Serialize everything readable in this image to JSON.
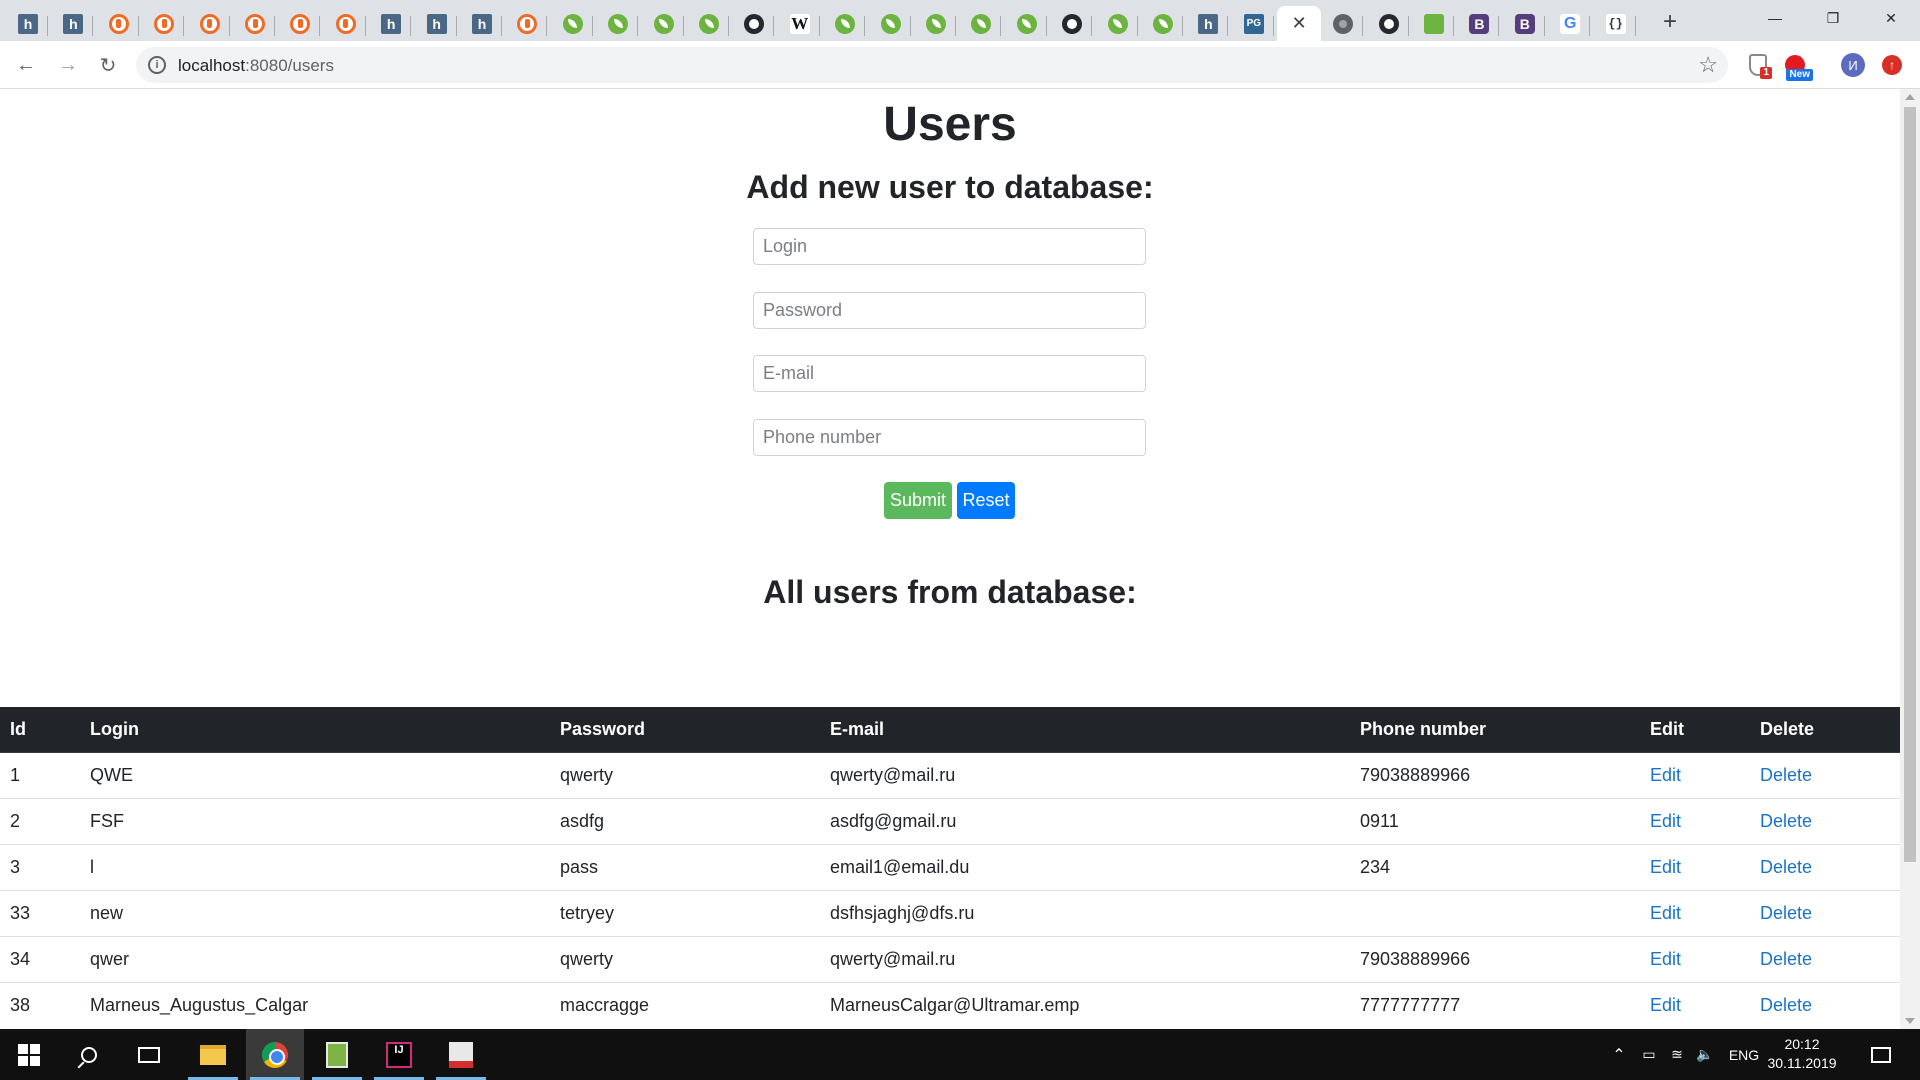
{
  "browser": {
    "tabs": [
      {
        "icon": "habr-icon",
        "glyph": "h"
      },
      {
        "icon": "habr-icon",
        "glyph": "h"
      },
      {
        "icon": "orange-site-icon",
        "glyph": ""
      },
      {
        "icon": "orange-site-icon",
        "glyph": ""
      },
      {
        "icon": "orange-site-icon",
        "glyph": ""
      },
      {
        "icon": "orange-site-icon",
        "glyph": ""
      },
      {
        "icon": "orange-site-icon",
        "glyph": ""
      },
      {
        "icon": "orange-site-icon",
        "glyph": ""
      },
      {
        "icon": "habr-icon",
        "glyph": "h"
      },
      {
        "icon": "habr-icon",
        "glyph": "h"
      },
      {
        "icon": "habr-icon",
        "glyph": "h"
      },
      {
        "icon": "orange-site-icon",
        "glyph": ""
      },
      {
        "icon": "spring-icon",
        "glyph": ""
      },
      {
        "icon": "spring-icon",
        "glyph": ""
      },
      {
        "icon": "spring-icon",
        "glyph": ""
      },
      {
        "icon": "spring-icon",
        "glyph": ""
      },
      {
        "icon": "github-icon",
        "glyph": ""
      },
      {
        "icon": "wikipedia-icon",
        "glyph": "W"
      },
      {
        "icon": "spring-icon",
        "glyph": ""
      },
      {
        "icon": "spring-icon",
        "glyph": ""
      },
      {
        "icon": "spring-icon",
        "glyph": ""
      },
      {
        "icon": "spring-icon",
        "glyph": ""
      },
      {
        "icon": "spring-icon",
        "glyph": ""
      },
      {
        "icon": "github-icon",
        "glyph": ""
      },
      {
        "icon": "spring-icon",
        "glyph": ""
      },
      {
        "icon": "spring-icon",
        "glyph": ""
      },
      {
        "icon": "habr-icon",
        "glyph": "h"
      },
      {
        "icon": "postgres-icon",
        "glyph": "PG"
      },
      {
        "icon": "active-tab-close-icon",
        "glyph": "✕"
      },
      {
        "icon": "globe-icon",
        "glyph": ""
      },
      {
        "icon": "github-icon",
        "glyph": ""
      },
      {
        "icon": "spring-boot-icon",
        "glyph": ""
      },
      {
        "icon": "bootstrap-icon",
        "glyph": "B"
      },
      {
        "icon": "bootstrap-icon",
        "glyph": "B"
      },
      {
        "icon": "google-icon",
        "glyph": "G"
      },
      {
        "icon": "json-icon",
        "glyph": "{}"
      }
    ],
    "new_tab": "+",
    "window_controls": {
      "minimize": "—",
      "maximize": "❐",
      "close": "✕"
    },
    "address": {
      "host": "localhost",
      "rest": ":8080/users"
    },
    "extensions": {
      "shield_badge": "1",
      "new_badge": "New",
      "avatar_letter": "И"
    }
  },
  "page": {
    "title": "Users",
    "form_title": "Add new user to database:",
    "fields": {
      "login_placeholder": "Login",
      "password_placeholder": "Password",
      "email_placeholder": "E-mail",
      "phone_placeholder": "Phone number"
    },
    "buttons": {
      "submit": "Submit",
      "reset": "Reset"
    },
    "list_title": "All users from database:",
    "table": {
      "columns": [
        "Id",
        "Login",
        "Password",
        "E-mail",
        "Phone number",
        "Edit",
        "Delete"
      ],
      "rows": [
        {
          "id": "1",
          "login": "QWE",
          "password": "qwerty",
          "email": "qwerty@mail.ru",
          "phone": "79038889966",
          "edit": "Edit",
          "delete": "Delete"
        },
        {
          "id": "2",
          "login": "FSF",
          "password": "asdfg",
          "email": "asdfg@gmail.ru",
          "phone": "0911",
          "edit": "Edit",
          "delete": "Delete"
        },
        {
          "id": "3",
          "login": "l",
          "password": "pass",
          "email": "email1@email.du",
          "phone": "234",
          "edit": "Edit",
          "delete": "Delete"
        },
        {
          "id": "33",
          "login": "new",
          "password": "tetryey",
          "email": "dsfhsjaghj@dfs.ru",
          "phone": "",
          "edit": "Edit",
          "delete": "Delete"
        },
        {
          "id": "34",
          "login": "qwer",
          "password": "qwerty",
          "email": "qwerty@mail.ru",
          "phone": "79038889966",
          "edit": "Edit",
          "delete": "Delete"
        },
        {
          "id": "38",
          "login": "Marneus_Augustus_Calgar",
          "password": "maccragge",
          "email": "MarneusCalgar@Ultramar.emp",
          "phone": "7777777777",
          "edit": "Edit",
          "delete": "Delete"
        }
      ]
    }
  },
  "taskbar": {
    "apps": [
      "start-icon",
      "search-icon",
      "task-view-icon",
      "file-explorer-icon",
      "chrome-icon",
      "notepad-icon",
      "intellij-idea-icon",
      "pdf-viewer-icon"
    ],
    "idea_glyph": "IJ",
    "tray": {
      "language": "ENG",
      "time": "20:12",
      "date": "30.11.2019"
    }
  }
}
